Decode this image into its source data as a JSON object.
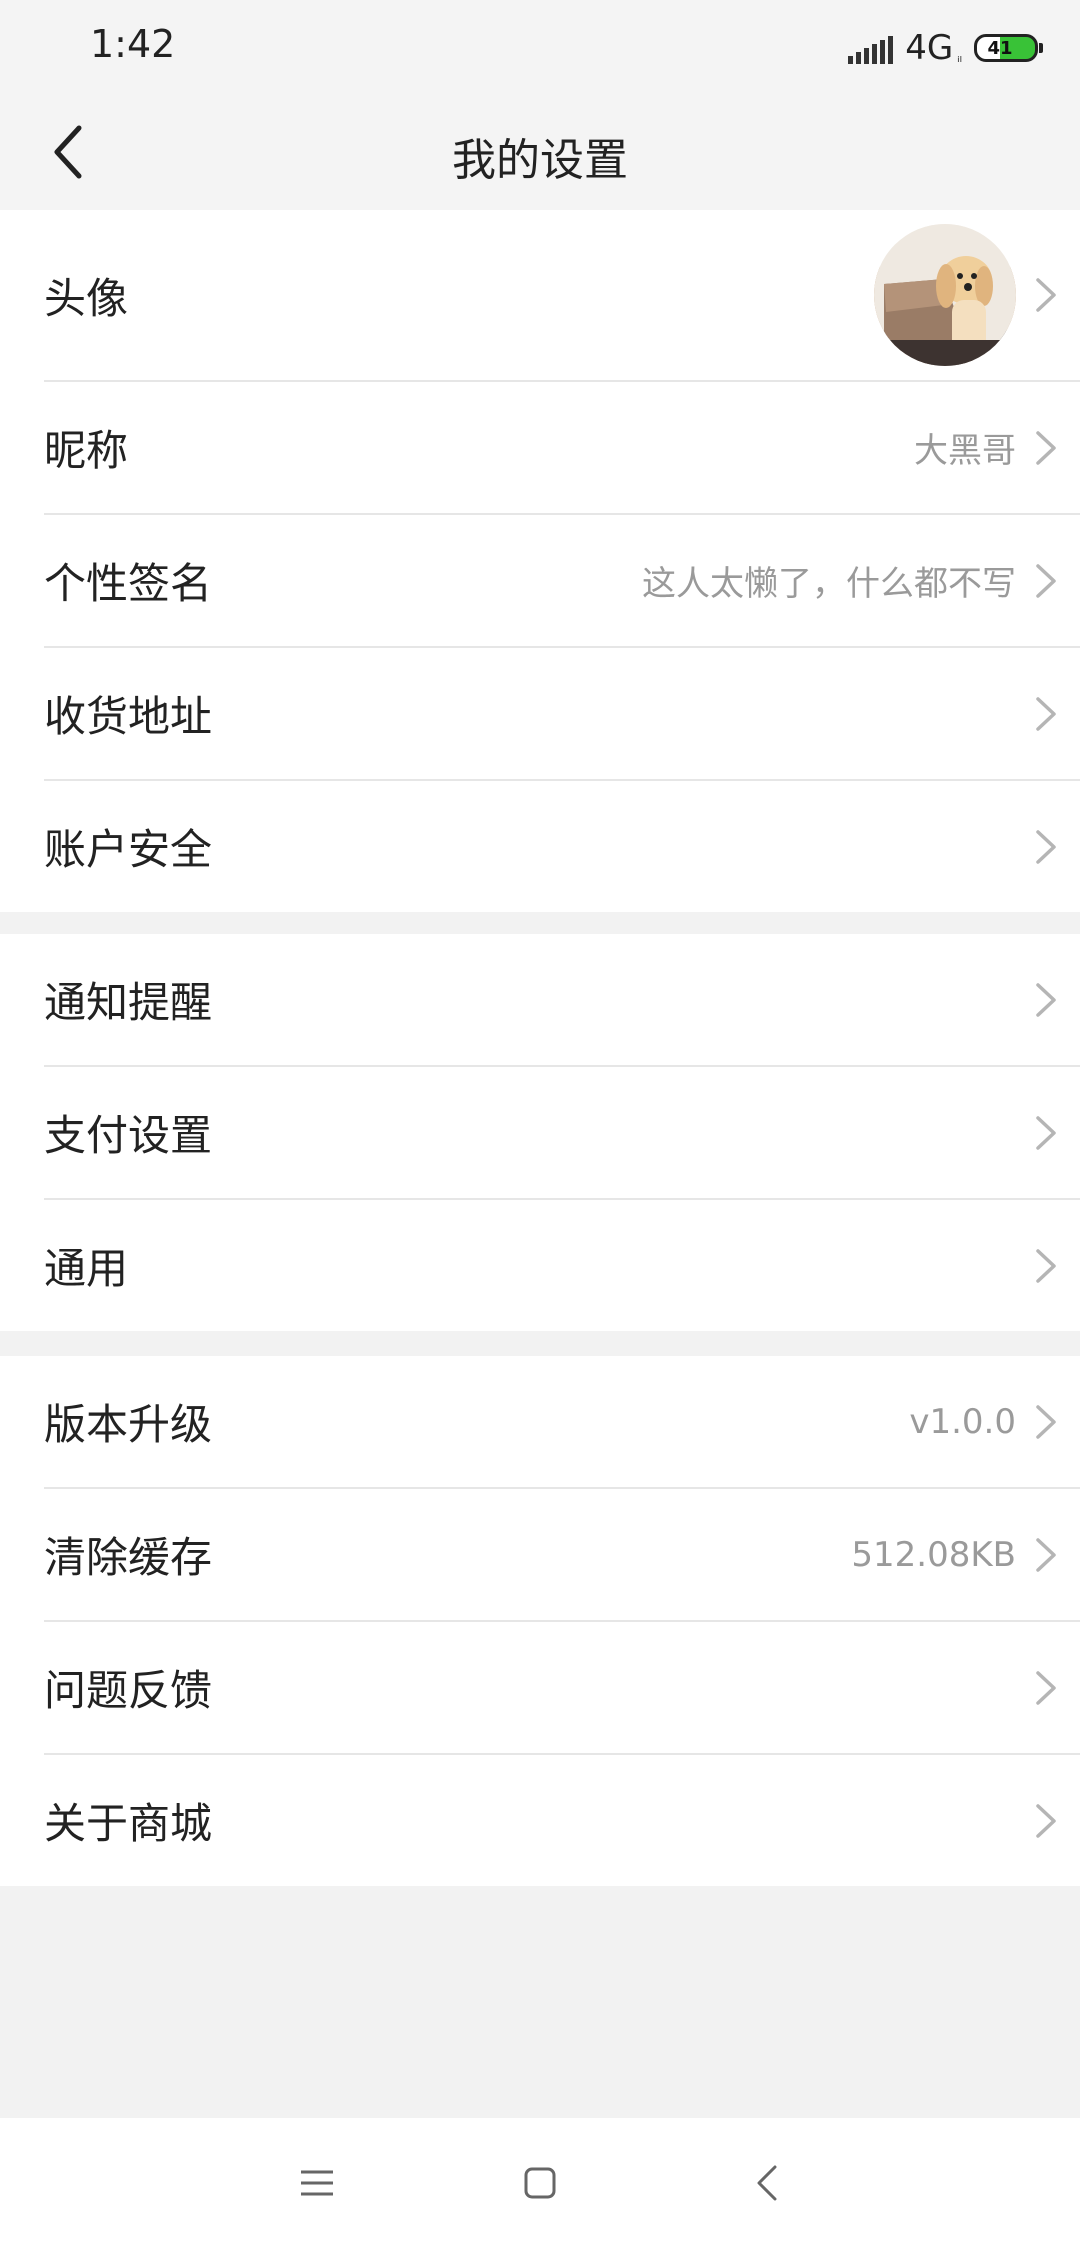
{
  "status_bar": {
    "time": "1:42",
    "network": "4G",
    "network_sub": "ᵢₗ",
    "battery": "41",
    "battery_level": 0.41
  },
  "header": {
    "title": "我的设置",
    "back_icon": "chevron-left-icon"
  },
  "groups": [
    {
      "rows": [
        {
          "label": "头像",
          "value": "",
          "type": "avatar"
        },
        {
          "label": "昵称",
          "value": "大黑哥"
        },
        {
          "label": "个性签名",
          "value": "这人太懒了，什么都不写"
        },
        {
          "label": "收货地址",
          "value": ""
        },
        {
          "label": "账户安全",
          "value": ""
        }
      ]
    },
    {
      "rows": [
        {
          "label": "通知提醒",
          "value": ""
        },
        {
          "label": "支付设置",
          "value": ""
        },
        {
          "label": "通用",
          "value": ""
        }
      ]
    },
    {
      "rows": [
        {
          "label": "版本升级",
          "value": "v1.0.0"
        },
        {
          "label": "清除缓存",
          "value": "512.08KB"
        },
        {
          "label": "问题反馈",
          "value": ""
        },
        {
          "label": "关于商城",
          "value": ""
        }
      ]
    }
  ],
  "system_nav": {
    "menu_icon": "menu-icon",
    "home_icon": "home-square-icon",
    "back_icon": "back-triangle-icon"
  },
  "colors": {
    "accent_battery": "#39c237",
    "value_text": "#9a9a9a",
    "background": "#f2f2f2"
  }
}
